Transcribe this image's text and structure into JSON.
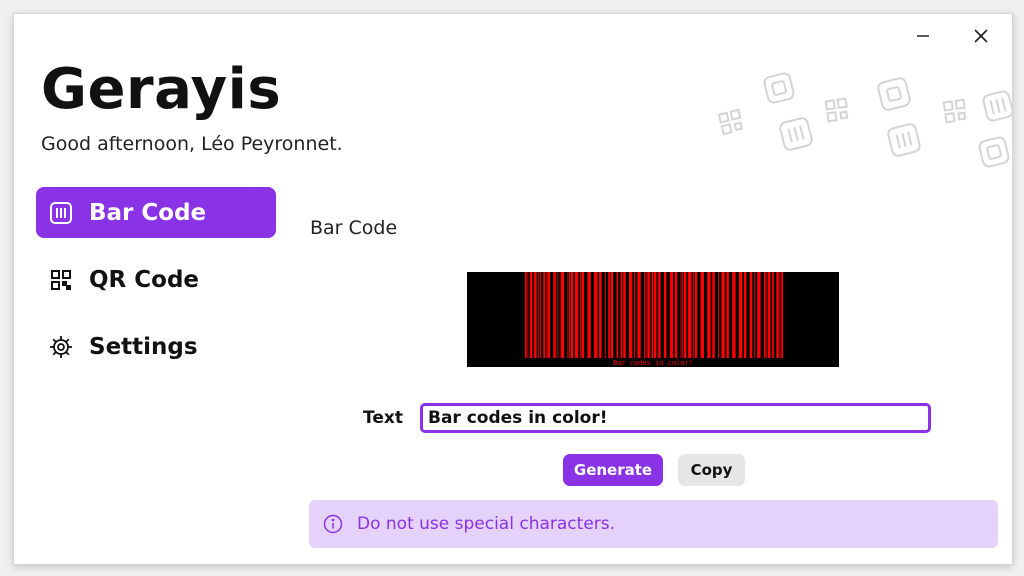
{
  "app": {
    "title": "Gerayis",
    "greeting": "Good afternoon, Léo Peyronnet."
  },
  "window_controls": {
    "minimize_icon": "minimize-icon",
    "close_icon": "close-icon"
  },
  "nav": {
    "items": [
      {
        "label": "Bar Code",
        "icon": "barcode-icon",
        "active": true
      },
      {
        "label": "QR Code",
        "icon": "qr-code-icon",
        "active": false
      },
      {
        "label": "Settings",
        "icon": "gear-icon",
        "active": false
      }
    ]
  },
  "main": {
    "section_title": "Bar Code",
    "barcode": {
      "encoded_text": "Bar codes in color!",
      "background": "#000000",
      "foreground": "#ff0000"
    },
    "field_label": "Text",
    "text_value": "Bar codes in color!",
    "generate_label": "Generate",
    "copy_label": "Copy",
    "info_icon": "info-icon",
    "info_text": "Do not use special characters."
  },
  "colors": {
    "accent": "#8a32e6",
    "info_background": "#e5d2fa"
  }
}
